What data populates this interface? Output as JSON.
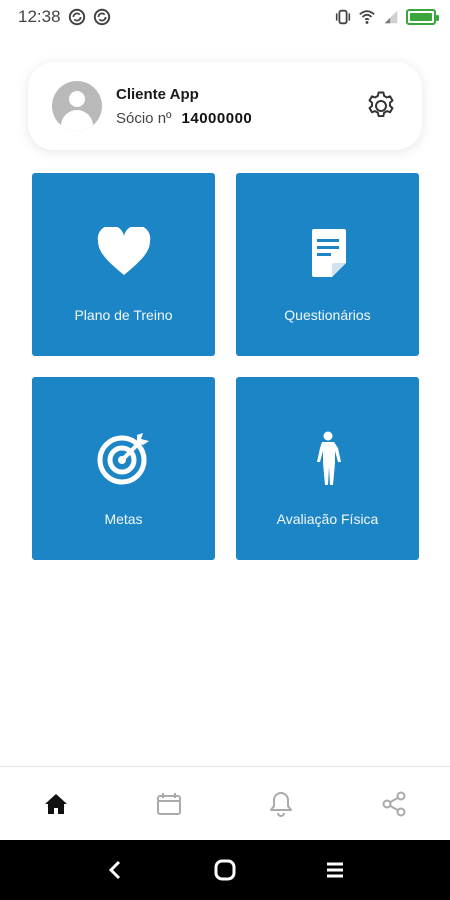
{
  "status_bar": {
    "time": "12:38",
    "icons": [
      "sync-icon",
      "sync-icon",
      "vibrate-icon",
      "wifi-icon",
      "signal-icon",
      "battery-icon"
    ],
    "battery_color": "#3aa53a"
  },
  "profile": {
    "name": "Cliente App",
    "member_label": "Sócio nº",
    "member_number": "14000000"
  },
  "tiles": [
    {
      "label": "Plano de Treino",
      "icon": "heart-icon"
    },
    {
      "label": "Questionários",
      "icon": "document-icon"
    },
    {
      "label": "Metas",
      "icon": "target-icon"
    },
    {
      "label": "Avaliação Física",
      "icon": "body-icon"
    }
  ],
  "bottom_nav": [
    {
      "icon": "home-icon",
      "active": true
    },
    {
      "icon": "calendar-icon",
      "active": false
    },
    {
      "icon": "bell-icon",
      "active": false
    },
    {
      "icon": "share-icon",
      "active": false
    }
  ],
  "system_nav": [
    "back-icon",
    "home-circle-icon",
    "recents-icon"
  ],
  "colors": {
    "tile_blue": "#1c85c6",
    "nav_active": "#111111",
    "nav_inactive": "#aaaaaa"
  }
}
